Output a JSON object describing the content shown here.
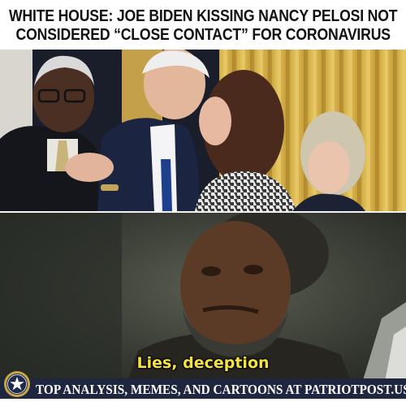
{
  "headline": {
    "line1": "WHITE HOUSE: JOE BIDEN KISSING NANCY PELOSI NOT",
    "line2": "CONSIDERED “CLOSE CONTACT” FOR CORONAVIRUS"
  },
  "meme": {
    "subtitle": "Lies, deception"
  },
  "footer": {
    "text": "TOP ANALYSIS, MEMES, AND CARTOONS AT PATRIOTPOST.US",
    "logo_icon": "patriot-post-star-seal-icon"
  },
  "colors": {
    "subtitle_yellow": "#f5e33c",
    "footer_bg": "#1f2740"
  }
}
